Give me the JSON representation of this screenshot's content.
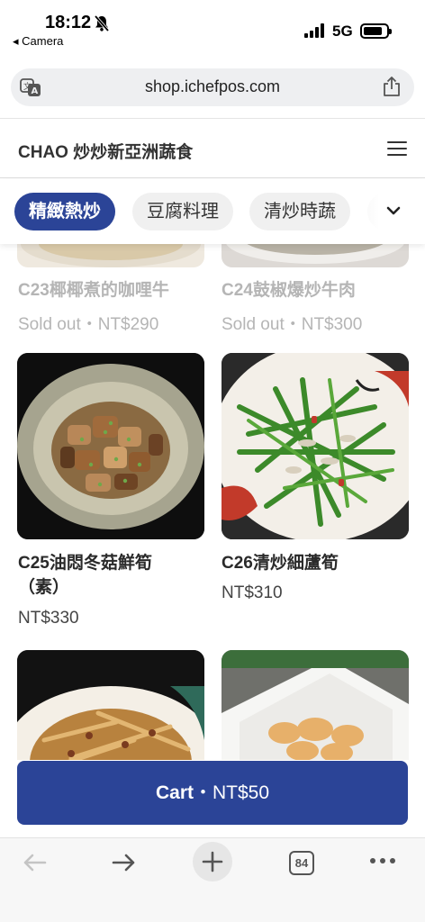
{
  "status_bar": {
    "time": "18:12",
    "back_app": "◂ Camera",
    "network": "5G"
  },
  "url_bar": {
    "url": "shop.ichefpos.com"
  },
  "store": {
    "name": "CHAO 炒炒新亞洲蔬食"
  },
  "tabs": [
    {
      "label": "精緻熱炒",
      "active": true
    },
    {
      "label": "豆腐料理",
      "active": false
    },
    {
      "label": "清炒時蔬",
      "active": false
    }
  ],
  "menu_items": [
    {
      "name": "C23椰椰煮的咖哩牛",
      "price": "Sold out・NT$290",
      "sold_out": true
    },
    {
      "name": "C24鼓椒爆炒牛肉",
      "price": "Sold out・NT$300",
      "sold_out": true
    },
    {
      "name": "C25油悶冬菇鮮筍\n（素）",
      "price": "NT$330",
      "sold_out": false
    },
    {
      "name": "C26清炒細蘆筍",
      "price": "NT$310",
      "sold_out": false
    }
  ],
  "cart": {
    "label": "Cart",
    "separator": "・",
    "total": "NT$50"
  },
  "toolbar": {
    "tab_count": "84"
  },
  "colors": {
    "brand": "#2b4497",
    "sold_out_text": "#b5b5b5"
  },
  "icons": [
    "bell-slash-icon",
    "signal-icon",
    "battery-icon",
    "translate-icon",
    "share-icon",
    "hamburger-menu-icon",
    "chevron-down-icon",
    "arrow-left-icon",
    "arrow-right-icon",
    "plus-icon",
    "tabs-icon",
    "more-icon"
  ]
}
